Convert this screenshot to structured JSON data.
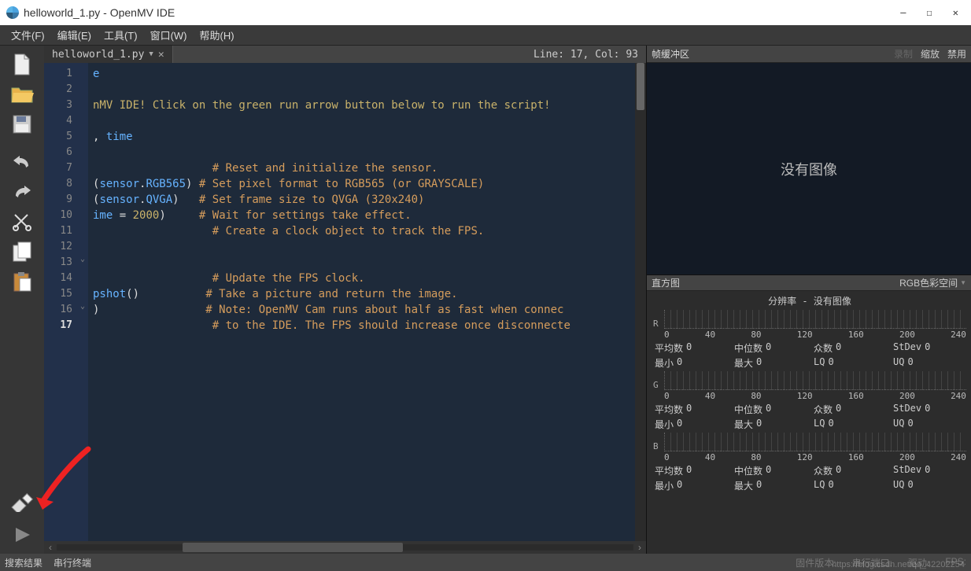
{
  "window": {
    "title": "helloworld_1.py - OpenMV IDE",
    "min": "—",
    "max": "☐",
    "close": "✕"
  },
  "menu": {
    "file": "文件(F)",
    "edit": "编辑(E)",
    "tools": "工具(T)",
    "window": "窗口(W)",
    "help": "帮助(H)"
  },
  "tab": {
    "name": "helloworld_1.py",
    "linecol": "Line: 17, Col: 93"
  },
  "code": {
    "lines": [
      {
        "n": 1,
        "html": "<span class='id'>e</span>"
      },
      {
        "n": 2,
        "html": ""
      },
      {
        "n": 3,
        "html": "<span class='lit'>nMV IDE! Click on the green run arrow button below to run the script!</span>"
      },
      {
        "n": 4,
        "html": ""
      },
      {
        "n": 5,
        "html": "<span class='op'>, </span><span class='id'>time</span>"
      },
      {
        "n": 6,
        "html": ""
      },
      {
        "n": 7,
        "html": "                  <span class='cmt'># Reset and initialize the sensor.</span>"
      },
      {
        "n": 8,
        "html": "<span class='op'>(</span><span class='id'>sensor</span><span class='op'>.</span><span class='attr'>RGB565</span><span class='op'>)</span> <span class='cmt'># Set pixel format to RGB565 (or GRAYSCALE)</span>"
      },
      {
        "n": 9,
        "html": "<span class='op'>(</span><span class='id'>sensor</span><span class='op'>.</span><span class='attr'>QVGA</span><span class='op'>)</span>   <span class='cmt'># Set frame size to QVGA (320x240)</span>"
      },
      {
        "n": 10,
        "html": "<span class='id'>ime</span> <span class='op'>=</span> <span class='num'>2000</span><span class='op'>)</span>     <span class='cmt'># Wait for settings take effect.</span>"
      },
      {
        "n": 11,
        "html": "                  <span class='cmt'># Create a clock object to track the FPS.</span>"
      },
      {
        "n": 12,
        "html": ""
      },
      {
        "n": 13,
        "html": ""
      },
      {
        "n": 14,
        "html": "                  <span class='cmt'># Update the FPS clock.</span>"
      },
      {
        "n": 15,
        "html": "<span class='id'>pshot</span><span class='op'>()</span>          <span class='cmt'># Take a picture and return the image.</span>"
      },
      {
        "n": 16,
        "html": "<span class='op'>)</span>                <span class='cmt'># Note: OpenMV Cam runs about half as fast when connec</span>"
      },
      {
        "n": 17,
        "html": "                  <span class='cmt'># to the IDE. The FPS should increase once disconnecte</span>",
        "current": true
      }
    ],
    "folds": {
      "13": "⌄",
      "16": "⌄"
    }
  },
  "framebuffer": {
    "title": "帧缓冲区",
    "record": "录制",
    "zoom": "缩放",
    "disable": "禁用",
    "placeholder": "没有图像"
  },
  "histogram": {
    "title": "直方图",
    "colorspace": "RGB色彩空间",
    "resolution": "分辨率 - 没有图像",
    "axis": [
      "0",
      "40",
      "80",
      "120",
      "160",
      "200",
      "240"
    ],
    "channels": [
      "R",
      "G",
      "B"
    ],
    "stats1_keys": [
      "平均数",
      "中位数",
      "众数",
      "StDev"
    ],
    "stats2_keys": [
      "最小",
      "最大",
      "LQ",
      "UQ"
    ],
    "zero": "0"
  },
  "statusbar": {
    "search": "搜索结果",
    "serial": "串行终端",
    "fw": "固件版本:",
    "port": "串行端口:",
    "drive": "驱动:",
    "fps": "FPS:"
  },
  "watermark": "https://blog.csdn.net/qq_42202254"
}
